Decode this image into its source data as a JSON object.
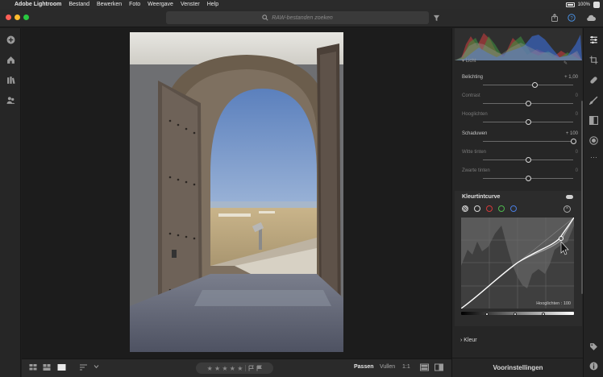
{
  "menubar": {
    "app_name": "Adobe Lightroom",
    "items": [
      "Bestand",
      "Bewerken",
      "Foto",
      "Weergave",
      "Venster",
      "Help"
    ],
    "battery": "100%"
  },
  "toolbar": {
    "search_placeholder": "RAW-bestanden zoeken"
  },
  "light_panel": {
    "heading": "Licht",
    "sliders": [
      {
        "label": "Belichting",
        "value": "+ 1,00",
        "level": 0.575,
        "active": true
      },
      {
        "label": "Contrast",
        "value": "0",
        "level": 0.5,
        "active": false
      },
      {
        "label": "Hooglichten",
        "value": "0",
        "level": 0.5,
        "active": false
      },
      {
        "label": "Schaduwen",
        "value": "+ 100",
        "level": 1.0,
        "active": true
      },
      {
        "label": "Witte tinten",
        "value": "0",
        "level": 0.5,
        "active": false
      },
      {
        "label": "Zwarte tinten",
        "value": "0",
        "level": 0.5,
        "active": false
      }
    ]
  },
  "tone_curve": {
    "title": "Kleurtintcurve",
    "readout": "Hooglichten : 100",
    "channels": [
      "parametric",
      "white",
      "red",
      "green",
      "blue"
    ],
    "channel_colors": [
      "#c8c8c8",
      "#d8d8d8",
      "#d23a3a",
      "#4db84d",
      "#4a7de0"
    ]
  },
  "color_section": {
    "label": "Kleur"
  },
  "presets_button": "Voorinstellingen",
  "bottombar": {
    "fit": "Passen",
    "fill": "Vullen",
    "ratio": "1:1",
    "stars": "★ ★ ★ ★ ★"
  },
  "colors": {
    "accent": "#4a90e2",
    "panel": "#262626",
    "canvas": "#1c1c1c"
  }
}
